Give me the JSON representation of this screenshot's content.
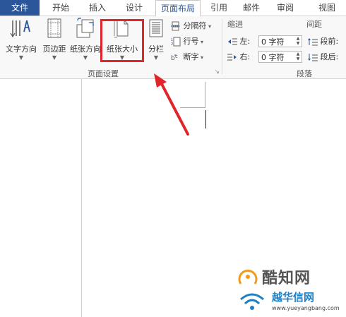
{
  "tabs": [
    {
      "label": "文件",
      "active": false
    },
    {
      "label": "开始",
      "active": false
    },
    {
      "label": "插入",
      "active": false
    },
    {
      "label": "设计",
      "active": false
    },
    {
      "label": "页面布局",
      "active": true
    },
    {
      "label": "引用",
      "active": false
    },
    {
      "label": "邮件",
      "active": false
    },
    {
      "label": "审阅",
      "active": false
    },
    {
      "label": "视图",
      "active": false
    }
  ],
  "ribbon": {
    "page_setup": {
      "label": "页面设置",
      "text_direction": "文字方向",
      "margins": "页边距",
      "orientation": "纸张方向",
      "size": "纸张大小",
      "columns": "分栏",
      "breaks": "分隔符",
      "line_numbers": "行号",
      "hyphenation": "断字"
    },
    "paragraph": {
      "label": "段落",
      "indent_title": "缩进",
      "spacing_title": "间距",
      "indent_left_label": "左:",
      "indent_left_value": "0 字符",
      "indent_right_label": "右:",
      "indent_right_value": "0 字符",
      "spacing_before_label": "段前:",
      "spacing_after_label": "段后:"
    }
  },
  "watermark": {
    "brand1": "酷知网",
    "brand2": "越华信网",
    "url": "www.yueyangbang.com"
  },
  "colors": {
    "file_tab": "#2b579a",
    "highlight": "#e0262a",
    "arrow": "#e0262a"
  }
}
